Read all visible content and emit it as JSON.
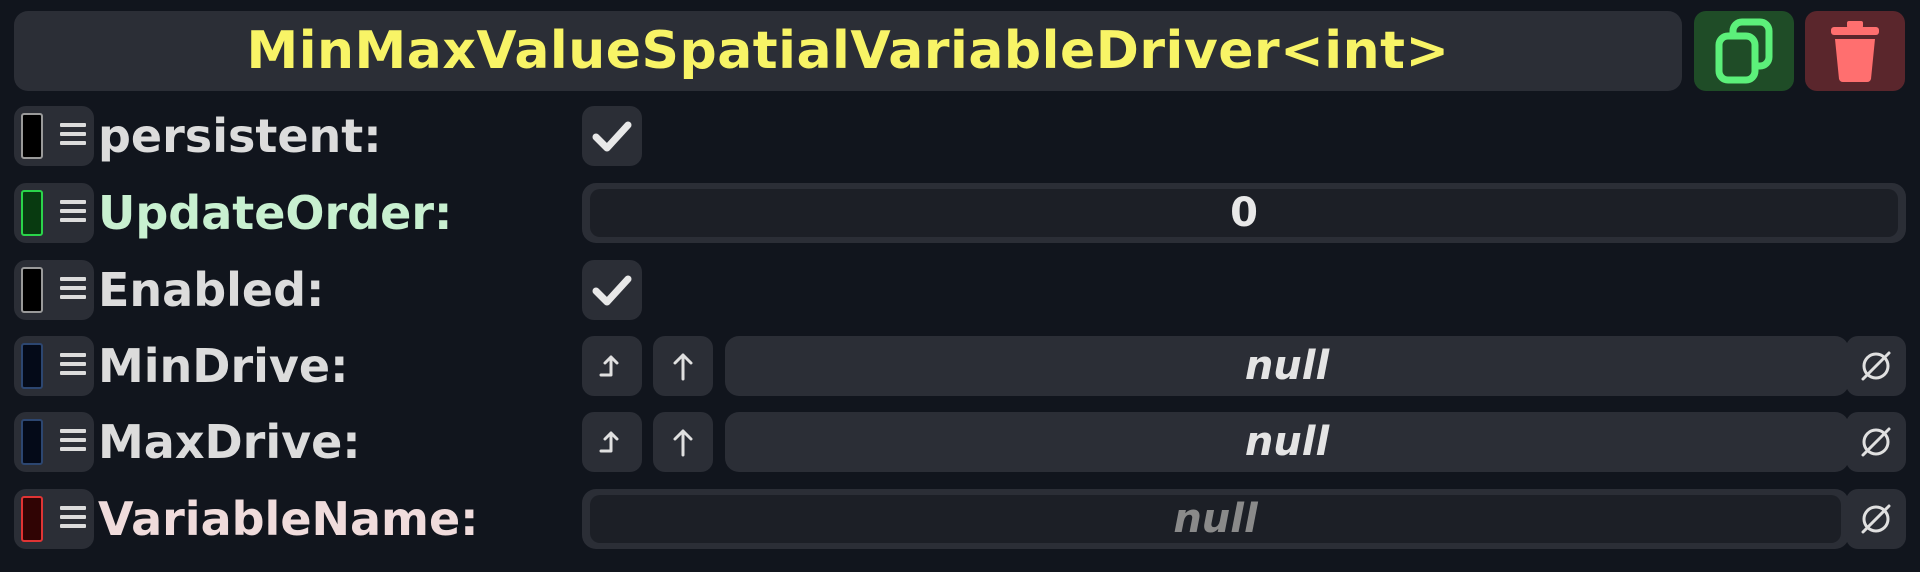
{
  "header": {
    "title": "MinMaxValueSpatialVariableDriver<int>",
    "duplicate_icon": "duplicate-icon",
    "delete_icon": "trash-icon"
  },
  "fields": {
    "persistent": {
      "label": "persistent:",
      "checked": true,
      "label_color": "#dcdcdc",
      "swatch": "#000000"
    },
    "update_order": {
      "label": "UpdateOrder:",
      "value": "0",
      "label_color": "#c8f0d0",
      "swatch": "#0f5f18"
    },
    "enabled": {
      "label": "Enabled:",
      "checked": true,
      "label_color": "#dcdcdc",
      "swatch": "#000000"
    },
    "min_drive": {
      "label": "MinDrive:",
      "value": "null",
      "label_color": "#dcdcdc",
      "swatch": "#081530"
    },
    "max_drive": {
      "label": "MaxDrive:",
      "value": "null",
      "label_color": "#dcdcdc",
      "swatch": "#081530"
    },
    "variable_name": {
      "label": "VariableName:",
      "value": "null",
      "label_color": "#f0dcdc",
      "swatch": "#5a0c0c"
    }
  },
  "colors": {
    "background": "#11151d",
    "panel": "#2b2e36",
    "title": "#f8f466",
    "duplicate_bg": "#1f4c27",
    "duplicate_fg": "#5cf07a",
    "delete_bg": "#5a262c",
    "delete_fg": "#ff6f6f"
  }
}
